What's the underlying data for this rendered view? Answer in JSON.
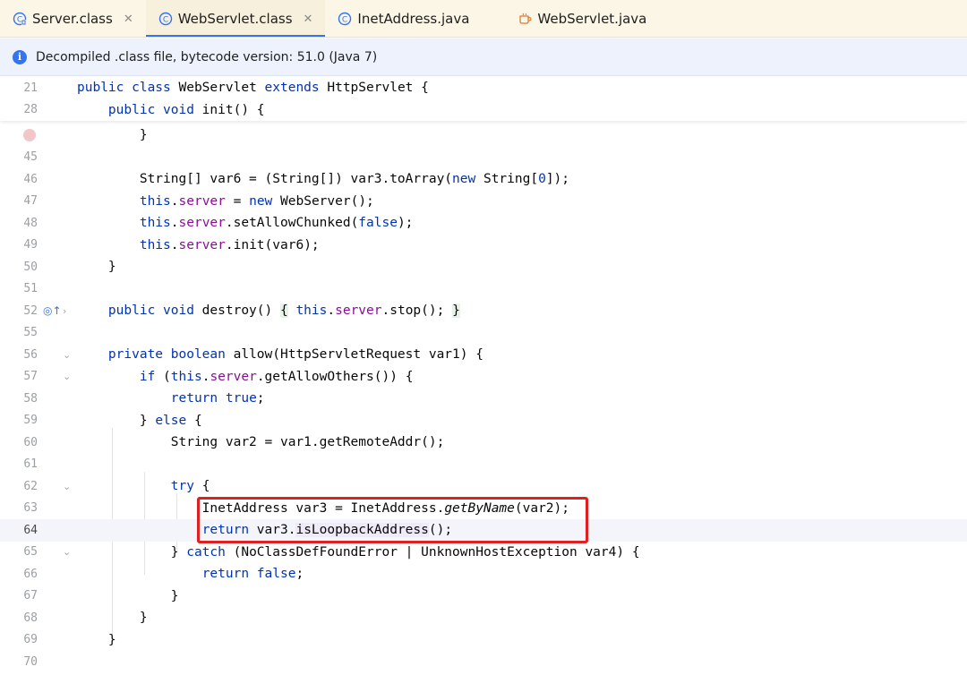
{
  "tabs": [
    {
      "label": "Server.class",
      "icon": "class-file-icon",
      "closable": true
    },
    {
      "label": "WebServlet.class",
      "icon": "class-file-icon",
      "closable": true,
      "active": true
    },
    {
      "label": "InetAddress.java",
      "icon": "class-icon",
      "closable": false
    },
    {
      "label": "WebServlet.java",
      "icon": "java-file-icon",
      "closable": false
    }
  ],
  "banner": {
    "text": "Decompiled .class file, bytecode version: 51.0 (Java 7)",
    "icon": "info-icon"
  },
  "lines": [
    {
      "num": "21",
      "text": "public class WebServlet extends HttpServlet {"
    },
    {
      "num": "28",
      "text": "    public void init() {"
    },
    {
      "num": "",
      "text": "        }"
    },
    {
      "num": "45",
      "text": ""
    },
    {
      "num": "46",
      "text": "        String[] var6 = (String[]) var3.toArray(new String[0]);"
    },
    {
      "num": "47",
      "text": "        this.server = new WebServer();"
    },
    {
      "num": "48",
      "text": "        this.server.setAllowChunked(false);"
    },
    {
      "num": "49",
      "text": "        this.server.init(var6);"
    },
    {
      "num": "50",
      "text": "    }"
    },
    {
      "num": "51",
      "text": ""
    },
    {
      "num": "52",
      "text": "    public void destroy() { this.server.stop(); }"
    },
    {
      "num": "55",
      "text": ""
    },
    {
      "num": "56",
      "text": "    private boolean allow(HttpServletRequest var1) {"
    },
    {
      "num": "57",
      "text": "        if (this.server.getAllowOthers()) {"
    },
    {
      "num": "58",
      "text": "            return true;"
    },
    {
      "num": "59",
      "text": "        } else {"
    },
    {
      "num": "60",
      "text": "            String var2 = var1.getRemoteAddr();"
    },
    {
      "num": "61",
      "text": ""
    },
    {
      "num": "62",
      "text": "            try {"
    },
    {
      "num": "63",
      "text": "                InetAddress var3 = InetAddress.getByName(var2);"
    },
    {
      "num": "64",
      "text": "                return var3.isLoopbackAddress();"
    },
    {
      "num": "65",
      "text": "            } catch (NoClassDefFoundError | UnknownHostException var4) {"
    },
    {
      "num": "66",
      "text": "                return false;"
    },
    {
      "num": "67",
      "text": "            }"
    },
    {
      "num": "68",
      "text": "        }"
    },
    {
      "num": "69",
      "text": "    }"
    },
    {
      "num": "70",
      "text": ""
    }
  ],
  "colors": {
    "keyword": "#0033b3",
    "field": "#871094",
    "highlight_box": "#e02020",
    "accent": "#3574f0"
  }
}
